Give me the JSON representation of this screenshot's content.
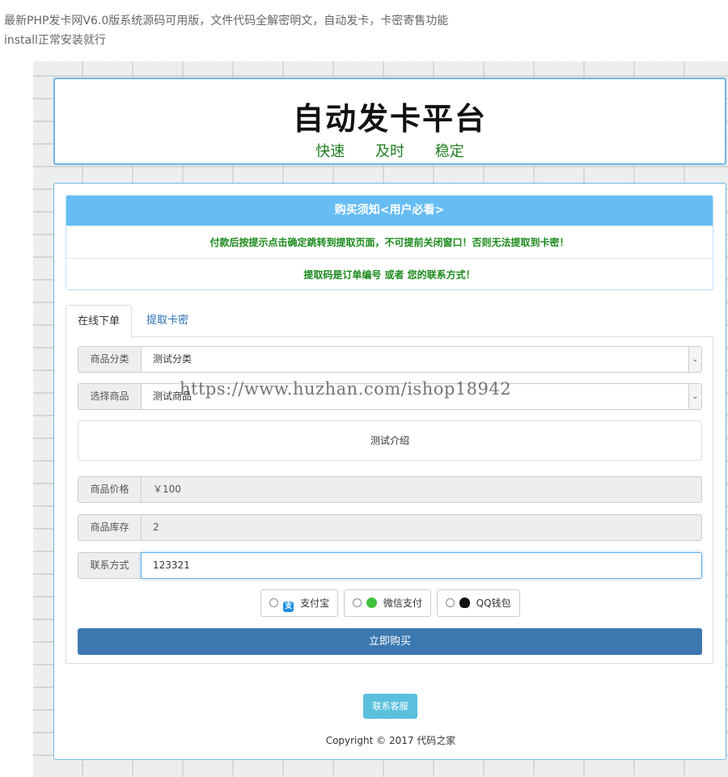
{
  "caption": {
    "line1": "最新PHP发卡网V6.0版系统源码可用版，文件代码全解密明文，自动发卡，卡密寄售功能",
    "line2": "install正常安装就行"
  },
  "header": {
    "title": "自动发卡平台",
    "slogan": [
      "快速",
      "及时",
      "稳定"
    ]
  },
  "notice": {
    "heading": "购买须知<用户必看>",
    "line1": "付款后按提示点击确定跳转到提取页面，不可提前关闭窗口！否则无法提取到卡密！",
    "line2": "提取码是订单编号 或者 您的联系方式！"
  },
  "tabs": {
    "order": "在线下单",
    "extract": "提取卡密"
  },
  "form": {
    "category_label": "商品分类",
    "category_value": "测试分类",
    "product_label": "选择商品",
    "product_value": "测试商品",
    "description": "测试介绍",
    "price_label": "商品价格",
    "price_value": "￥100",
    "stock_label": "商品库存",
    "stock_value": "2",
    "contact_label": "联系方式",
    "contact_value": "123321"
  },
  "payment": {
    "alipay": "支付宝",
    "wechat": "微信支付",
    "qq": "QQ钱包"
  },
  "buy_button": "立即购买",
  "service_button": "联系客服",
  "copyright": "Copyright © 2017 代码之家",
  "watermark": "https://www.huzhan.com/ishop18942",
  "colors": {
    "notice_header": "#66bdf3",
    "notice_text": "#1b8a1b",
    "buy_button": "#3c78b0",
    "service_button": "#5bc0de",
    "panel_border": "#6fb6e6"
  }
}
